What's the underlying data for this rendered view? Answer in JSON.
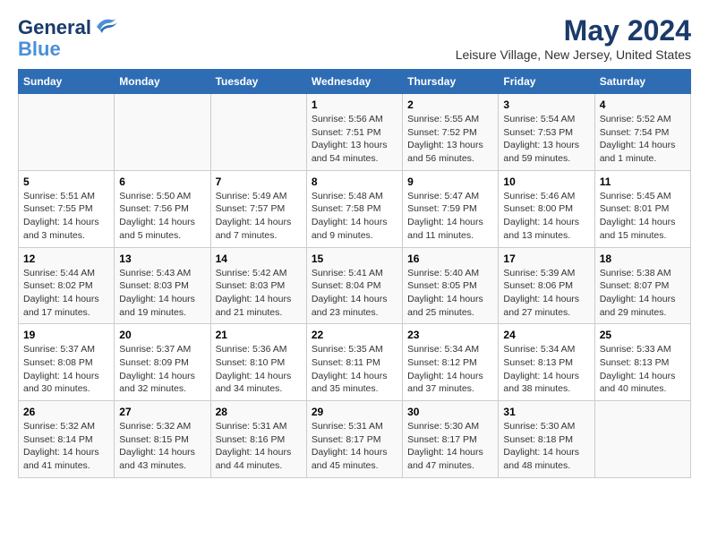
{
  "logo": {
    "line1": "General",
    "line2": "Blue"
  },
  "title": "May 2024",
  "subtitle": "Leisure Village, New Jersey, United States",
  "days_of_week": [
    "Sunday",
    "Monday",
    "Tuesday",
    "Wednesday",
    "Thursday",
    "Friday",
    "Saturday"
  ],
  "weeks": [
    [
      {
        "day": "",
        "info": ""
      },
      {
        "day": "",
        "info": ""
      },
      {
        "day": "",
        "info": ""
      },
      {
        "day": "1",
        "info": "Sunrise: 5:56 AM\nSunset: 7:51 PM\nDaylight: 13 hours\nand 54 minutes."
      },
      {
        "day": "2",
        "info": "Sunrise: 5:55 AM\nSunset: 7:52 PM\nDaylight: 13 hours\nand 56 minutes."
      },
      {
        "day": "3",
        "info": "Sunrise: 5:54 AM\nSunset: 7:53 PM\nDaylight: 13 hours\nand 59 minutes."
      },
      {
        "day": "4",
        "info": "Sunrise: 5:52 AM\nSunset: 7:54 PM\nDaylight: 14 hours\nand 1 minute."
      }
    ],
    [
      {
        "day": "5",
        "info": "Sunrise: 5:51 AM\nSunset: 7:55 PM\nDaylight: 14 hours\nand 3 minutes."
      },
      {
        "day": "6",
        "info": "Sunrise: 5:50 AM\nSunset: 7:56 PM\nDaylight: 14 hours\nand 5 minutes."
      },
      {
        "day": "7",
        "info": "Sunrise: 5:49 AM\nSunset: 7:57 PM\nDaylight: 14 hours\nand 7 minutes."
      },
      {
        "day": "8",
        "info": "Sunrise: 5:48 AM\nSunset: 7:58 PM\nDaylight: 14 hours\nand 9 minutes."
      },
      {
        "day": "9",
        "info": "Sunrise: 5:47 AM\nSunset: 7:59 PM\nDaylight: 14 hours\nand 11 minutes."
      },
      {
        "day": "10",
        "info": "Sunrise: 5:46 AM\nSunset: 8:00 PM\nDaylight: 14 hours\nand 13 minutes."
      },
      {
        "day": "11",
        "info": "Sunrise: 5:45 AM\nSunset: 8:01 PM\nDaylight: 14 hours\nand 15 minutes."
      }
    ],
    [
      {
        "day": "12",
        "info": "Sunrise: 5:44 AM\nSunset: 8:02 PM\nDaylight: 14 hours\nand 17 minutes."
      },
      {
        "day": "13",
        "info": "Sunrise: 5:43 AM\nSunset: 8:03 PM\nDaylight: 14 hours\nand 19 minutes."
      },
      {
        "day": "14",
        "info": "Sunrise: 5:42 AM\nSunset: 8:03 PM\nDaylight: 14 hours\nand 21 minutes."
      },
      {
        "day": "15",
        "info": "Sunrise: 5:41 AM\nSunset: 8:04 PM\nDaylight: 14 hours\nand 23 minutes."
      },
      {
        "day": "16",
        "info": "Sunrise: 5:40 AM\nSunset: 8:05 PM\nDaylight: 14 hours\nand 25 minutes."
      },
      {
        "day": "17",
        "info": "Sunrise: 5:39 AM\nSunset: 8:06 PM\nDaylight: 14 hours\nand 27 minutes."
      },
      {
        "day": "18",
        "info": "Sunrise: 5:38 AM\nSunset: 8:07 PM\nDaylight: 14 hours\nand 29 minutes."
      }
    ],
    [
      {
        "day": "19",
        "info": "Sunrise: 5:37 AM\nSunset: 8:08 PM\nDaylight: 14 hours\nand 30 minutes."
      },
      {
        "day": "20",
        "info": "Sunrise: 5:37 AM\nSunset: 8:09 PM\nDaylight: 14 hours\nand 32 minutes."
      },
      {
        "day": "21",
        "info": "Sunrise: 5:36 AM\nSunset: 8:10 PM\nDaylight: 14 hours\nand 34 minutes."
      },
      {
        "day": "22",
        "info": "Sunrise: 5:35 AM\nSunset: 8:11 PM\nDaylight: 14 hours\nand 35 minutes."
      },
      {
        "day": "23",
        "info": "Sunrise: 5:34 AM\nSunset: 8:12 PM\nDaylight: 14 hours\nand 37 minutes."
      },
      {
        "day": "24",
        "info": "Sunrise: 5:34 AM\nSunset: 8:13 PM\nDaylight: 14 hours\nand 38 minutes."
      },
      {
        "day": "25",
        "info": "Sunrise: 5:33 AM\nSunset: 8:13 PM\nDaylight: 14 hours\nand 40 minutes."
      }
    ],
    [
      {
        "day": "26",
        "info": "Sunrise: 5:32 AM\nSunset: 8:14 PM\nDaylight: 14 hours\nand 41 minutes."
      },
      {
        "day": "27",
        "info": "Sunrise: 5:32 AM\nSunset: 8:15 PM\nDaylight: 14 hours\nand 43 minutes."
      },
      {
        "day": "28",
        "info": "Sunrise: 5:31 AM\nSunset: 8:16 PM\nDaylight: 14 hours\nand 44 minutes."
      },
      {
        "day": "29",
        "info": "Sunrise: 5:31 AM\nSunset: 8:17 PM\nDaylight: 14 hours\nand 45 minutes."
      },
      {
        "day": "30",
        "info": "Sunrise: 5:30 AM\nSunset: 8:17 PM\nDaylight: 14 hours\nand 47 minutes."
      },
      {
        "day": "31",
        "info": "Sunrise: 5:30 AM\nSunset: 8:18 PM\nDaylight: 14 hours\nand 48 minutes."
      },
      {
        "day": "",
        "info": ""
      }
    ]
  ]
}
